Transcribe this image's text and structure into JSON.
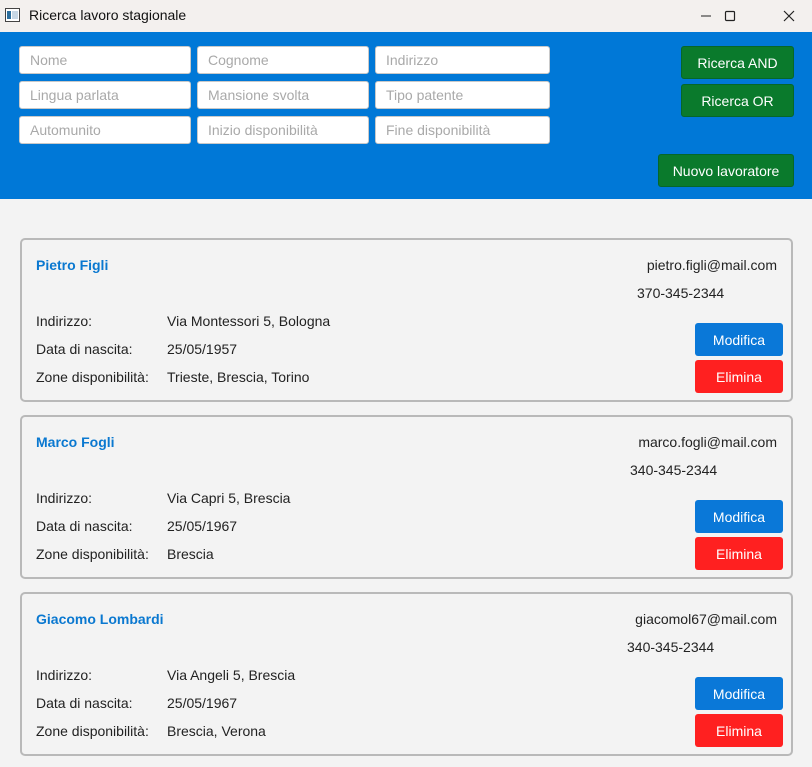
{
  "window": {
    "title": "Ricerca lavoro stagionale"
  },
  "search": {
    "fields": [
      {
        "placeholder": "Nome",
        "value": ""
      },
      {
        "placeholder": "Cognome",
        "value": ""
      },
      {
        "placeholder": "Indirizzo",
        "value": ""
      },
      {
        "placeholder": "Lingua parlata",
        "value": ""
      },
      {
        "placeholder": "Mansione svolta",
        "value": ""
      },
      {
        "placeholder": "Tipo patente",
        "value": ""
      },
      {
        "placeholder": "Automunito",
        "value": ""
      },
      {
        "placeholder": "Inizio disponibilità",
        "value": ""
      },
      {
        "placeholder": "Fine disponibilità",
        "value": ""
      }
    ],
    "and_label": "Ricerca AND",
    "or_label": "Ricerca OR",
    "new_worker_label": "Nuovo lavoratore"
  },
  "labels": {
    "address": "Indirizzo:",
    "birth": "Data di nascita:",
    "zones": "Zone disponibilità:",
    "edit": "Modifica",
    "delete": "Elimina"
  },
  "workers": [
    {
      "name": "Pietro Figli",
      "email": "pietro.figli@mail.com",
      "phone": "370-345-2344",
      "address": "Via Montessori 5, Bologna",
      "birth": "25/05/1957",
      "zones": "Trieste, Brescia, Torino"
    },
    {
      "name": "Marco Fogli",
      "email": "marco.fogli@mail.com",
      "phone": "340-345-2344",
      "address": "Via Capri 5, Brescia",
      "birth": "25/05/1967",
      "zones": "Brescia"
    },
    {
      "name": "Giacomo Lombardi",
      "email": "giacomol67@mail.com",
      "phone": "340-345-2344",
      "address": "Via Angeli 5, Brescia",
      "birth": "25/05/1967",
      "zones": "Brescia, Verona"
    }
  ],
  "colors": {
    "toolbar": "#0078d7",
    "green_button": "#0a7a2c",
    "edit_button": "#0a78d8",
    "delete_button": "#ff2020",
    "name_text": "#0a78d0"
  }
}
